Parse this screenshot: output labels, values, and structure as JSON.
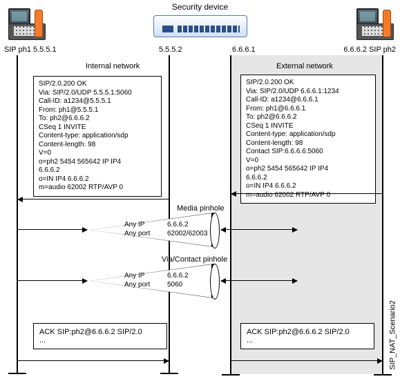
{
  "title": "Security device",
  "endpoints": {
    "left_phone_label": "SIP ph1 5.5.5.1",
    "right_phone_label": "6.6.6.2 SIP ph2",
    "device_left_ip": "5.5.5.2",
    "device_right_ip": "6.6.6.1"
  },
  "networks": {
    "internal_label": "Internal network",
    "external_label": "External network"
  },
  "messages": {
    "internal_200ok": [
      "SIP/2.0.200 OK",
      "Via: SIP/2.0/UDP 5.5.5.1:5060",
      "Call-ID: a1234@5.5.5.1",
      "From: ph1@5.5.5.1",
      "To: ph2@6.6.6.2",
      "CSeq 1 INVITE",
      "Content-type: application/sdp",
      "Content-length: 98",
      "V=0",
      "o=ph2 5454 565642 IP IP4",
      "6.6.6.2",
      "o=IN IP4 6.6.6.2",
      "m=audio 62002 RTP/AVP 0"
    ],
    "external_200ok": [
      "SIP/2.0.200 OK",
      "Via: SIP/2.0/UDP 6.6.6.1:1234",
      "Call-ID: a1234@6.6.6.1",
      "From: ph1@6.6.6.1",
      "To: ph2@6.6.6.2",
      "CSeq 1 INVITE",
      "Content-type: application/sdp",
      "Content-length: 98",
      "Contact SIP:6.6.6.6:5060",
      "V=0",
      "o=ph2 5454 565642 IP IP4",
      "6.6.6.2",
      "o=IN IP4 6.6.6.2",
      "m=audio 62002 RTP/AVP 0"
    ]
  },
  "pinholes": {
    "media": {
      "label": "Media pinhole",
      "left_text": "Any IP\nAny port",
      "right_text": "6.6.6.2\n62002/62003"
    },
    "via": {
      "label": "Via/Contact pinhole",
      "left_text": "Any IP\nAny port",
      "right_text": "6.6.6.2\n5060"
    }
  },
  "acks": {
    "internal": "ACK SIP:ph2@6.6.6.2 SIP/2.0\n...",
    "external": "ACK SIP:ph2@6.6.6.2 SIP/2.0\n..."
  },
  "side_label": "SIP_NAT_Scenario2"
}
